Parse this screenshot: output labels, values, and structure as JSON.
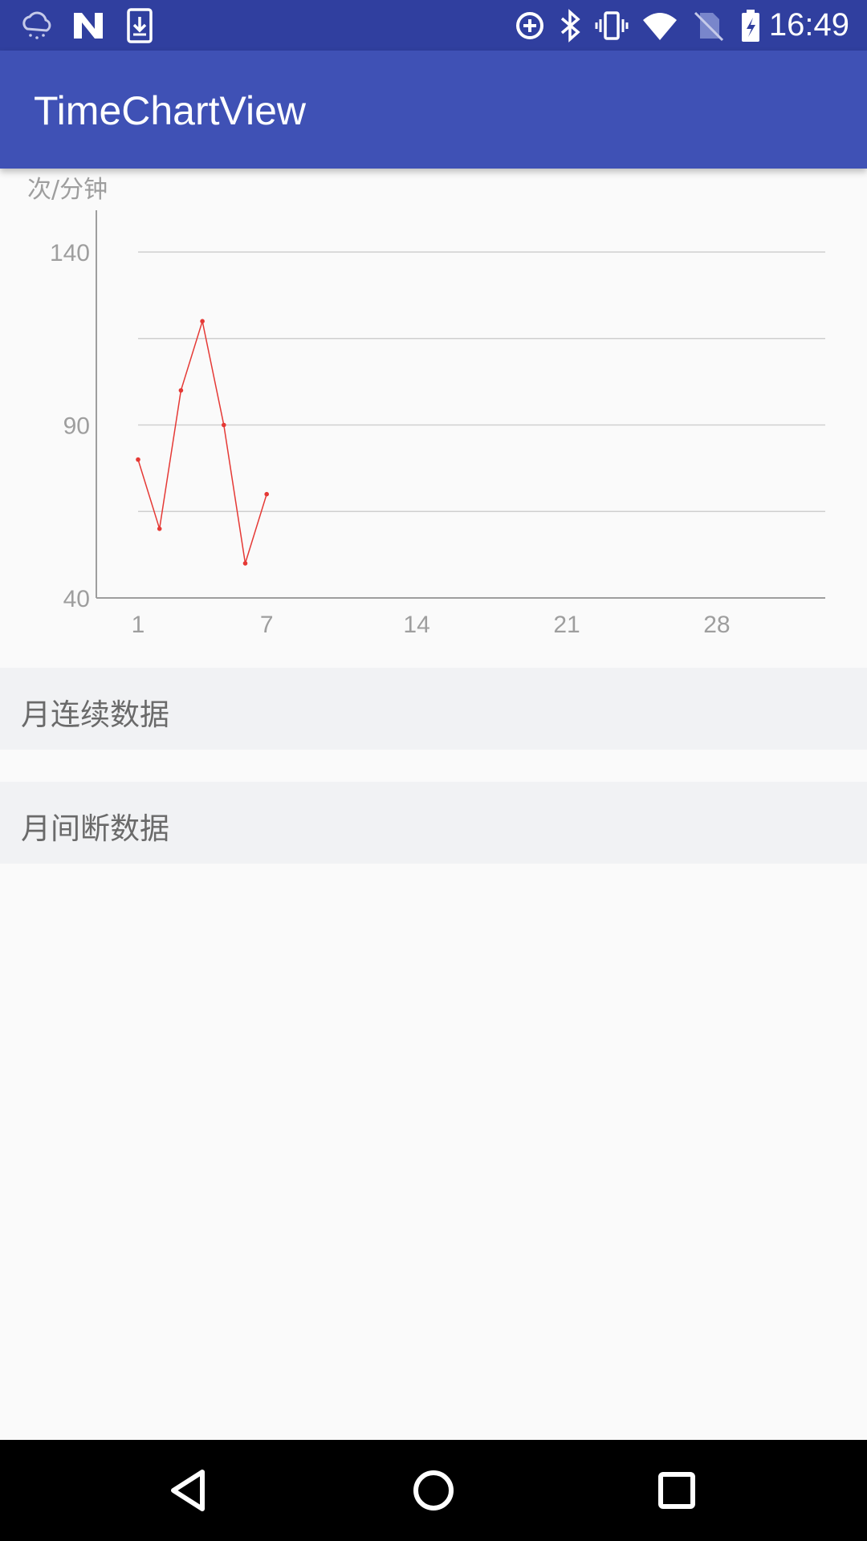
{
  "status_bar": {
    "time": "16:49",
    "icons_left": [
      "weather-cloud-icon",
      "n-logo-icon",
      "download-icon"
    ],
    "icons_right": [
      "data-saver-icon",
      "bluetooth-icon",
      "vibrate-icon",
      "wifi-icon",
      "no-sim-icon",
      "battery-icon"
    ]
  },
  "app_bar": {
    "title": "TimeChartView"
  },
  "chart_data": {
    "type": "line",
    "ylabel": "次/分钟",
    "ylim": [
      40,
      140
    ],
    "yticks": [
      "140",
      "90",
      "40"
    ],
    "xlim": [
      1,
      31
    ],
    "xticks": [
      "1",
      "7",
      "14",
      "21",
      "28"
    ],
    "grid": true,
    "series": [
      {
        "x": [
          1,
          2,
          3,
          4,
          5,
          6,
          7
        ],
        "values": [
          80,
          60,
          100,
          120,
          90,
          50,
          70
        ]
      }
    ],
    "colors": {
      "line": "#e53935",
      "axis": "#9e9e9e",
      "grid": "#cfcfcf",
      "label": "#9e9e9e"
    }
  },
  "list": [
    {
      "label": "月连续数据"
    },
    {
      "label": "月间断数据"
    }
  ],
  "nav_bar": {
    "buttons": [
      "back-icon",
      "home-icon",
      "recents-icon"
    ]
  }
}
